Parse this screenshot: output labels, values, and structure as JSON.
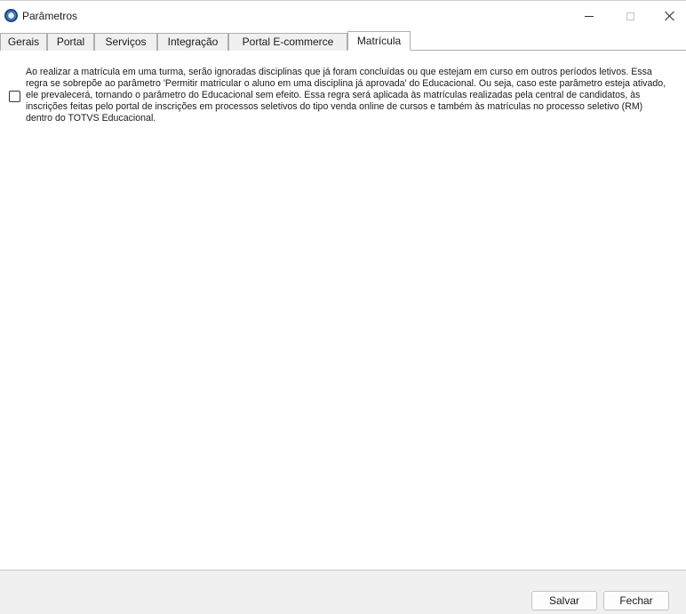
{
  "window": {
    "title": "Parâmetros",
    "icon": "app-logo-icon",
    "controls": {
      "minimize_icon": "minimize-icon",
      "maximize_icon": "maximize-icon",
      "close_icon": "close-icon"
    }
  },
  "tabs": [
    {
      "label": "Gerais",
      "active": false
    },
    {
      "label": "Portal",
      "active": false
    },
    {
      "label": "Serviços",
      "active": false
    },
    {
      "label": "Integração",
      "active": false
    },
    {
      "label": "Portal E-commerce",
      "active": false
    },
    {
      "label": "Matrícula",
      "active": true
    }
  ],
  "matricula": {
    "checkbox_checked": false,
    "description": "Ao realizar a matrícula em uma turma, serão ignoradas disciplinas que já foram concluídas ou que estejam em curso em outros períodos letivos. Essa\nregra se sobrepõe ao parâmetro 'Permitir matricular o aluno em uma disciplina já aprovada' do Educacional. Ou seja, caso este parâmetro esteja ativado,\nele prevalecerá, tornando o parâmetro do Educacional sem efeito. Essa regra será aplicada às matrículas realizadas pela central de candidatos, às\ninscrições feitas pelo portal de inscrições em processos seletivos do tipo venda online de cursos e também às matrículas no processo seletivo (RM)\ndentro do TOTVS Educacional."
  },
  "footer": {
    "save_label": "Salvar",
    "close_label": "Fechar"
  },
  "colors": {
    "footer_bg": "#f0f0f0",
    "tab_bg": "#f0f0f0",
    "border": "#adadad"
  }
}
